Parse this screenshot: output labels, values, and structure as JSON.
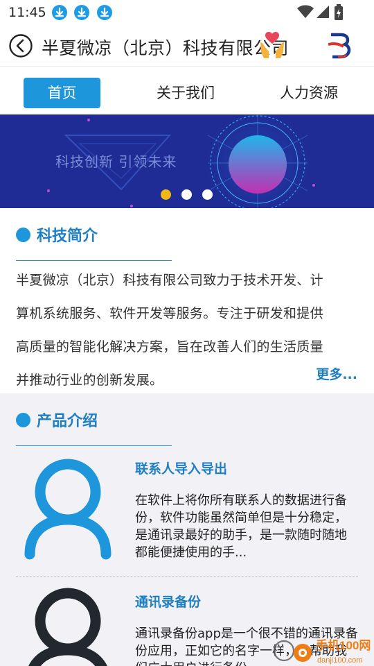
{
  "status": {
    "time": "11:45"
  },
  "titlebar": {
    "title": "半夏微凉（北京）科技有限公司"
  },
  "tabs": [
    {
      "label": "首页",
      "active": true
    },
    {
      "label": "关于我们",
      "active": false
    },
    {
      "label": "人力资源",
      "active": false
    }
  ],
  "banner": {
    "slogan": "科技创新  引领未来",
    "slide_count": 3,
    "active_slide": 1
  },
  "intro": {
    "heading": "科技简介",
    "lines": [
      "半夏微凉（北京）科技有限公司致力于技术开发、计",
      "算机系统服务、软件开发等服务。专注于研发和提供",
      "高质量的智能化解决方案，旨在改善人们的生活质量",
      "并推动行业的创新发展。"
    ],
    "more": "更多..."
  },
  "products": {
    "heading": "产品介绍",
    "items": [
      {
        "name": "联系人导入导出",
        "desc": "在软件上将你所有联系人的数据进行备份，软件功能虽然简单但是十分稳定，是通讯录最好的助手，是一款随时随地都能便捷使用的手..."
      },
      {
        "name": "通讯录备份",
        "desc": "通讯录备份app是一个很不错的通讯录备份应用，正如它的名字一样，是帮助我们广大用户进行备份"
      }
    ]
  },
  "watermark": {
    "text": "手机100网",
    "sub": "danji100.com"
  },
  "colors": {
    "accent": "#1e96dc",
    "heading": "#1e7fc4",
    "banner": "#1f2c95",
    "active_dot": "#f0b816"
  },
  "icons": [
    "download-icon",
    "wifi-icon",
    "signal-icon",
    "battery-icon",
    "back-icon",
    "heart-hands-icon",
    "company-logo",
    "person-icon"
  ]
}
